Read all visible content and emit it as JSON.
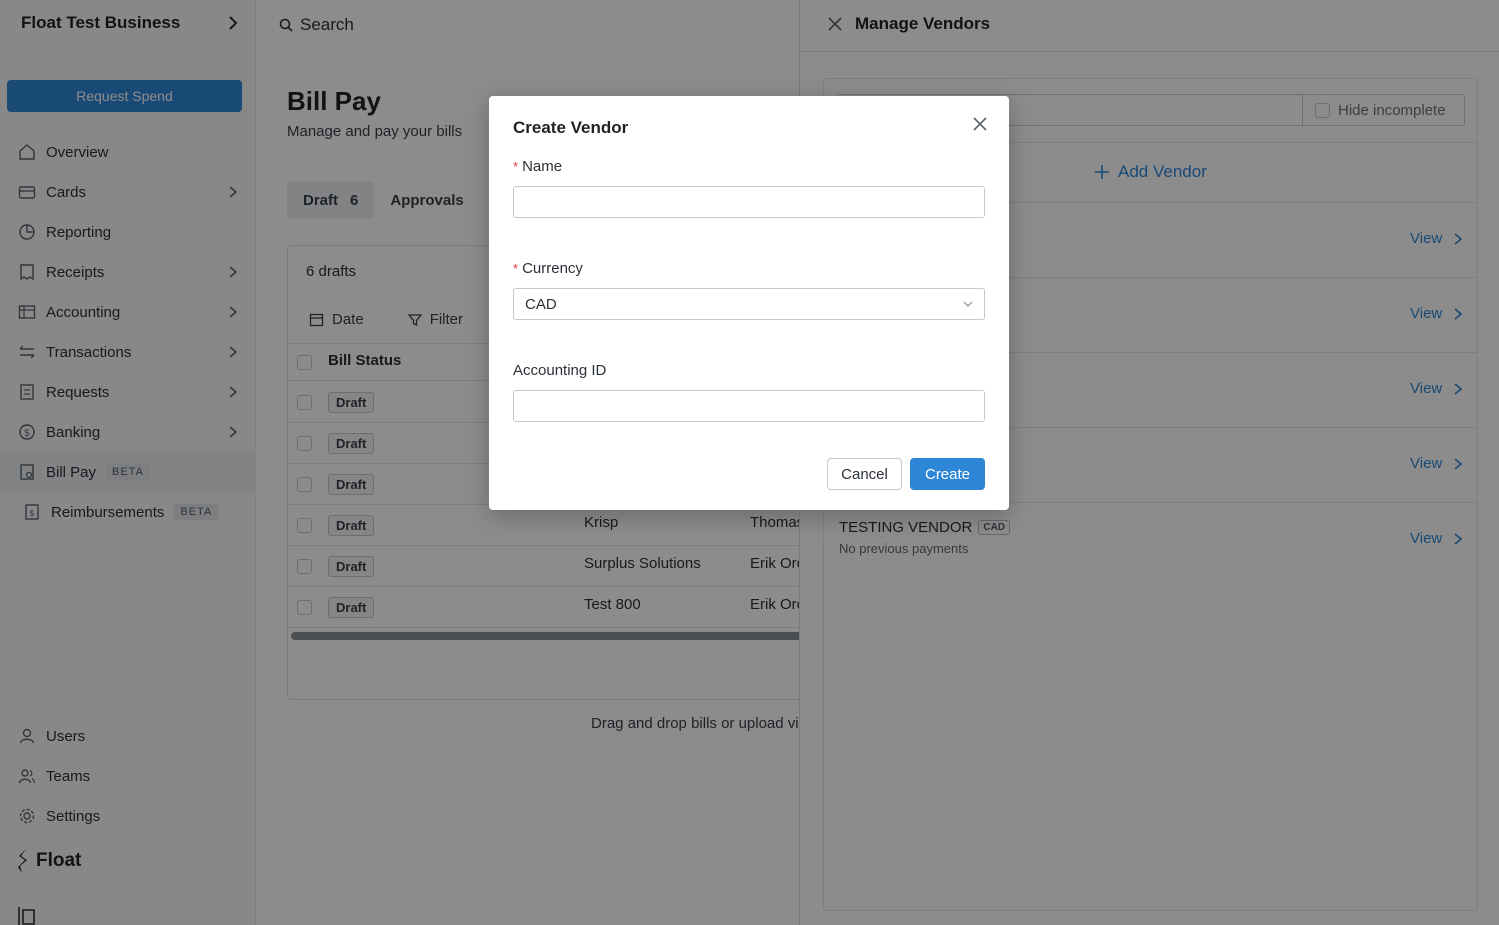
{
  "sidebar": {
    "business_name": "Float Test Business",
    "request_button": "Request Spend",
    "items": [
      {
        "label": "Overview",
        "icon": "home-icon"
      },
      {
        "label": "Cards",
        "icon": "card-icon"
      },
      {
        "label": "Reporting",
        "icon": "pie-chart-icon"
      },
      {
        "label": "Receipts",
        "icon": "receipt-icon"
      },
      {
        "label": "Accounting",
        "icon": "table-icon"
      },
      {
        "label": "Transactions",
        "icon": "transfer-icon"
      },
      {
        "label": "Requests",
        "icon": "request-icon"
      },
      {
        "label": "Banking",
        "icon": "dollar-icon"
      },
      {
        "label": "Bill Pay",
        "icon": "bill-icon",
        "badge": "BETA"
      },
      {
        "label": "Reimbursements",
        "icon": "reimburse-icon",
        "badge": "BETA"
      }
    ],
    "bottom_items": [
      {
        "label": "Users",
        "icon": "user-icon"
      },
      {
        "label": "Teams",
        "icon": "team-icon"
      },
      {
        "label": "Settings",
        "icon": "gear-icon"
      }
    ],
    "logo_text": "Float"
  },
  "header": {
    "search_label": "Search"
  },
  "main": {
    "title": "Bill Pay",
    "subtitle": "Manage and pay your bills",
    "tabs": [
      {
        "label": "Draft",
        "count": "6"
      },
      {
        "label": "Approvals"
      }
    ],
    "drafts_count": "6 drafts",
    "filters": {
      "date": "Date",
      "filter": "Filter"
    },
    "column_header": "Bill Status",
    "rows": [
      {
        "status": "Draft",
        "vendor": "",
        "owner": ""
      },
      {
        "status": "Draft",
        "vendor": "",
        "owner": ""
      },
      {
        "status": "Draft",
        "vendor": "",
        "owner": ""
      },
      {
        "status": "Draft",
        "vendor": "Krisp",
        "owner": "Thomas"
      },
      {
        "status": "Draft",
        "vendor": "Surplus Solutions",
        "owner": "Erik Orc"
      },
      {
        "status": "Draft",
        "vendor": "Test 800",
        "owner": "Erik Orc"
      }
    ],
    "drop_note": "Drag and drop bills or upload vi"
  },
  "panel": {
    "title": "Manage Vendors",
    "hide_incomplete": "Hide incomplete",
    "add_vendor": "Add Vendor",
    "view_label": "View",
    "last_vendor": {
      "name": "TESTING VENDOR",
      "currency": "CAD",
      "note": "No previous payments"
    }
  },
  "modal": {
    "title": "Create Vendor",
    "name_label": "Name",
    "name_value": "",
    "currency_label": "Currency",
    "currency_value": "CAD",
    "accounting_label": "Accounting ID",
    "accounting_value": "",
    "required_mark": "*",
    "cancel": "Cancel",
    "create": "Create"
  },
  "colors": {
    "accent": "#2e86d6",
    "required": "#d93b3b"
  }
}
